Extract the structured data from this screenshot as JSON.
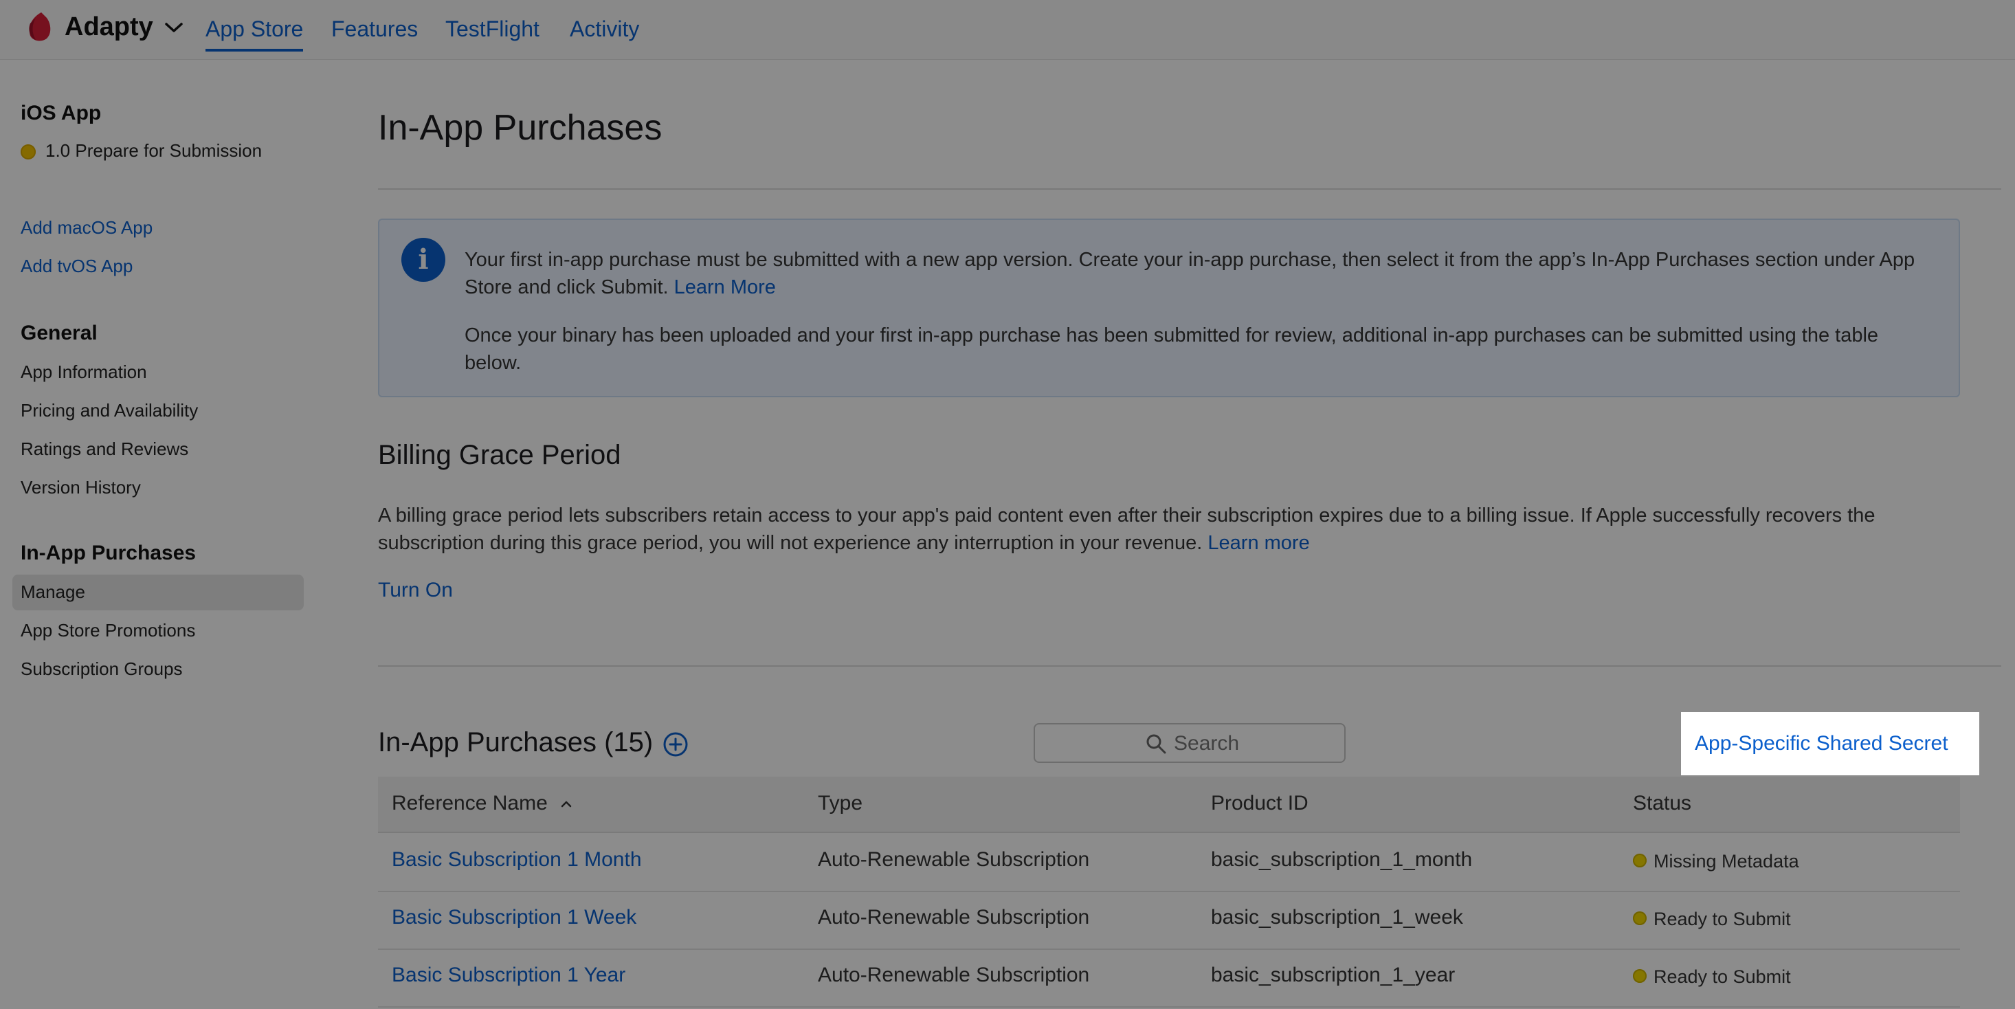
{
  "topnav": {
    "brand": "Adapty",
    "tabs": [
      {
        "label": "App Store",
        "active": true
      },
      {
        "label": "Features",
        "active": false
      },
      {
        "label": "TestFlight",
        "active": false
      },
      {
        "label": "Activity",
        "active": false
      }
    ]
  },
  "sidebar": {
    "app_heading": "iOS App",
    "app_status": "1.0 Prepare for Submission",
    "add_links": [
      "Add macOS App",
      "Add tvOS App"
    ],
    "general": {
      "heading": "General",
      "items": [
        "App Information",
        "Pricing and Availability",
        "Ratings and Reviews",
        "Version History"
      ]
    },
    "iap": {
      "heading": "In-App Purchases",
      "items": [
        "Manage",
        "App Store Promotions",
        "Subscription Groups"
      ],
      "active": "Manage"
    }
  },
  "main": {
    "title": "In-App Purchases",
    "info": {
      "p1": "Your first in-app purchase must be submitted with a new app version. Create your in-app purchase, then select it from the app’s In-App Purchases section under App Store and click Submit.",
      "p1_link": "Learn More",
      "p2": "Once your binary has been uploaded and your first in-app purchase has been submitted for review, additional in-app purchases can be submitted using the table below."
    },
    "billing": {
      "title": "Billing Grace Period",
      "text": "A billing grace period lets subscribers retain access to your app's paid content even after their subscription expires due to a billing issue. If Apple successfully recovers the subscription during this grace period, you will not experience any interruption in your revenue.",
      "link": "Learn more",
      "action": "Turn On"
    },
    "iap_section": {
      "title": "In-App Purchases (15)",
      "search_placeholder": "Search",
      "shared_secret": "App-Specific Shared Secret"
    },
    "table": {
      "headers": [
        "Reference Name",
        "Type",
        "Product ID",
        "Status"
      ],
      "rows": [
        {
          "name": "Basic Subscription 1 Month",
          "type": "Auto-Renewable Subscription",
          "product_id": "basic_subscription_1_month",
          "status": "Missing Metadata"
        },
        {
          "name": "Basic Subscription 1 Week",
          "type": "Auto-Renewable Subscription",
          "product_id": "basic_subscription_1_week",
          "status": "Ready to Submit"
        },
        {
          "name": "Basic Subscription 1 Year",
          "type": "Auto-Renewable Subscription",
          "product_id": "basic_subscription_1_year",
          "status": "Ready to Submit"
        }
      ]
    }
  },
  "colors": {
    "link": "#0b5fcc",
    "overlay": "rgba(0,0,0,0.45)",
    "status_yellow": "#f2d800"
  },
  "icons": [
    "adapty-logo-icon",
    "chevron-down-icon",
    "info-icon",
    "add-circle-icon",
    "search-icon",
    "sort-ascending-icon",
    "status-dot-icon"
  ]
}
